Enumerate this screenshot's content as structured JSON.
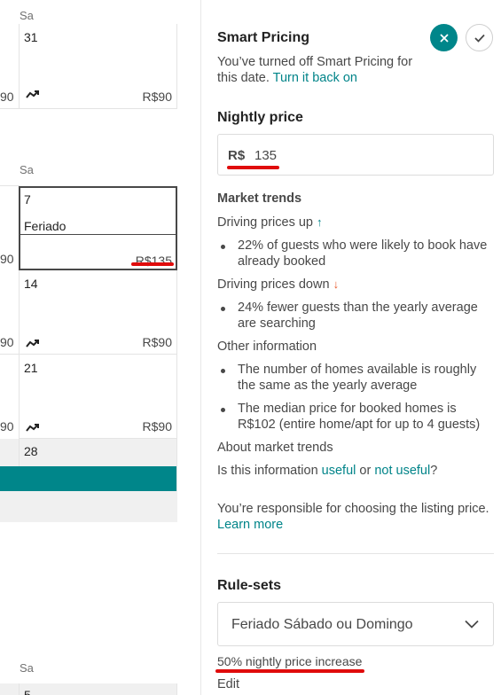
{
  "calendar": {
    "day_header": "Sa",
    "week1": {
      "day": "31",
      "left_price": "90",
      "price": "R$90"
    },
    "week2": {
      "day": "7",
      "label": "Feriado",
      "left_price": "90",
      "price": "R$135"
    },
    "week3": {
      "day": "14",
      "left_price": "90",
      "price": "R$90"
    },
    "week4": {
      "day": "21",
      "left_price": "90",
      "price": "R$90"
    },
    "week5": {
      "day": "28"
    },
    "week6": {
      "day": "5"
    },
    "trend_icon": "trend-icon",
    "colors": {
      "booked_bar": "#00868a",
      "highlight": "#e00b0b"
    }
  },
  "panel": {
    "smart_pricing": {
      "title": "Smart Pricing",
      "desc": "You’ve turned off Smart Pricing for this date.",
      "link": "Turn it back on",
      "close_icon": "close-icon",
      "check_icon": "check-icon"
    },
    "nightly_price": {
      "title": "Nightly price",
      "currency": "R$",
      "value": "135"
    },
    "market_trends": {
      "title": "Market trends",
      "up_label": "Driving prices up",
      "up_items": [
        "22% of guests who were likely to book have already booked"
      ],
      "down_label": "Driving prices down",
      "down_items": [
        "24% fewer guests than the yearly average are searching"
      ],
      "other_label": "Other information",
      "other_items": [
        "The number of homes available is roughly the same as the yearly average",
        "The median price for booked homes is R$102 (entire home/apt for up to 4 guests)"
      ],
      "about_link": "About market trends",
      "feedback_prefix": "Is this information",
      "useful": "useful",
      "or": "or",
      "not_useful": "not useful",
      "qmark": "?"
    },
    "responsibility": {
      "text": "You’re responsible for choosing the listing price.",
      "link": "Learn more"
    },
    "rule_sets": {
      "title": "Rule-sets",
      "selected": "Feriado Sábado ou Domingo",
      "rule": "50% nightly price increase",
      "edit": "Edit"
    }
  }
}
